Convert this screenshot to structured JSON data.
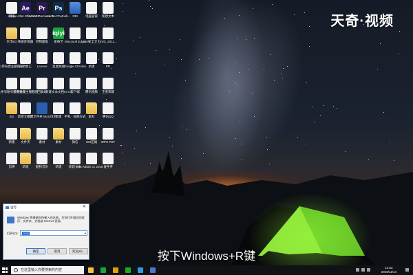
{
  "brand": {
    "text": "天奇·视频"
  },
  "subtitle": "按下Windows+R键",
  "desktop_icons": [
    {
      "label": "网络",
      "icon": "network-icon"
    },
    {
      "label": "Adobe After Effects CC ...",
      "icon": "after-effects-icon",
      "abbr": "Ae",
      "color": "#2a1c5c"
    },
    {
      "label": "Adobe Premiere P...",
      "icon": "premiere-icon",
      "abbr": "Pr",
      "color": "#2a1a4c"
    },
    {
      "label": "Adobe Photosh...",
      "icon": "photoshop-icon",
      "abbr": "Ps",
      "color": "#0f2a4c"
    },
    {
      "label": "333",
      "icon": "folder-blue-icon"
    },
    {
      "label": "电脑管家",
      "icon": "tencent-pc-manager-icon"
    },
    {
      "label": "新建文本",
      "icon": "text-file-icon"
    },
    {
      "label": "王玲BO",
      "icon": "folder-icon"
    },
    {
      "label": "快速连接器",
      "icon": "document-icon"
    },
    {
      "label": "控制面板",
      "icon": "control-panel-icon"
    },
    {
      "label": "爱奇艺",
      "icon": "iqiyi-icon",
      "abbr": "iqiyi",
      "color": "#17a53d"
    },
    {
      "label": "Microsoft Edge",
      "icon": "edge-icon"
    },
    {
      "label": "360安全卫士",
      "icon": "360-icon"
    },
    {
      "label": "SVD_2011...",
      "icon": "doc-file-icon"
    },
    {
      "label": "1月份营业额统计",
      "icon": "document-icon"
    },
    {
      "label": "员销售汇",
      "icon": "document-icon"
    },
    {
      "label": "Lenovo",
      "icon": "lenovo-icon"
    },
    {
      "label": "百度网盘",
      "icon": "baidu-netdisk-icon"
    },
    {
      "label": "Google Chrome",
      "icon": "chrome-icon"
    },
    {
      "label": "新建",
      "icon": "document-icon"
    },
    {
      "label": "PR",
      "icon": "document-icon"
    },
    {
      "label": "头条号账号截图数据",
      "icon": "document-icon"
    },
    {
      "label": "天奇视频主播截图",
      "icon": "document-icon"
    },
    {
      "label": "回收站",
      "icon": "recycle-bin-icon"
    },
    {
      "label": "新建文本文档07.txt",
      "icon": "document-icon"
    },
    {
      "label": "客户端",
      "icon": "computer-icon"
    },
    {
      "label": "腾讯视频",
      "icon": "tencent-video-icon"
    },
    {
      "label": "王者荣耀",
      "icon": "document-icon"
    },
    {
      "label": "BG",
      "icon": "folder-icon"
    },
    {
      "label": "新建文件夹",
      "icon": "document-icon"
    },
    {
      "label": "新建文件夹 Word文档",
      "icon": "word-icon"
    },
    {
      "label": "新建",
      "icon": "document-icon"
    },
    {
      "label": "手机 - 视频方式",
      "icon": "document-icon"
    },
    {
      "label": "素材",
      "icon": "folder-icon"
    },
    {
      "label": "腾讯QQ",
      "icon": "qq-icon"
    },
    {
      "label": "新建",
      "icon": "document-icon"
    },
    {
      "label": "文件夹",
      "icon": "folder-icon"
    },
    {
      "label": "素材",
      "icon": "document-icon"
    },
    {
      "label": "素材",
      "icon": "folder-icon"
    },
    {
      "label": "微信",
      "icon": "wechat-icon"
    },
    {
      "label": "360压缩",
      "icon": "zip-icon"
    },
    {
      "label": "WPS PDF",
      "icon": "wps-pdf-icon"
    },
    {
      "label": "剪映",
      "icon": "capcut-icon"
    },
    {
      "label": "新建",
      "icon": "folder-icon"
    },
    {
      "label": "酷狗音乐",
      "icon": "kugou-icon"
    },
    {
      "label": "新建",
      "icon": "document-icon"
    },
    {
      "label": "新建文本",
      "icon": "document-icon"
    },
    {
      "label": "Win Adobe cc 2018 注",
      "icon": "document-icon"
    },
    {
      "label": "文件夹",
      "icon": "document-icon"
    }
  ],
  "run_dialog": {
    "title": "运行",
    "description": "Windows 将根据你所输入的名称，为你打开相应的程序、文件夹、文档或 Internet 资源。",
    "open_label": "打开(O):",
    "input_value": "cmd",
    "ok": "确定",
    "cancel": "取消",
    "browse": "浏览(B)..."
  },
  "taskbar": {
    "search_placeholder": "在这里输入你要搜索的内容",
    "time": "14:52",
    "date": "2019/11/14",
    "apps": [
      {
        "icon": "file-explorer-icon",
        "color": "#f0c24a"
      },
      {
        "icon": "iqiyi-icon",
        "color": "#17a53d"
      },
      {
        "icon": "chrome-icon",
        "color": "#e0a100"
      },
      {
        "icon": "wechat-icon",
        "color": "#1aad19"
      },
      {
        "icon": "qq-icon",
        "color": "#2b9ce2"
      },
      {
        "icon": "explorer-icon",
        "color": "#4a7ac7"
      }
    ]
  }
}
